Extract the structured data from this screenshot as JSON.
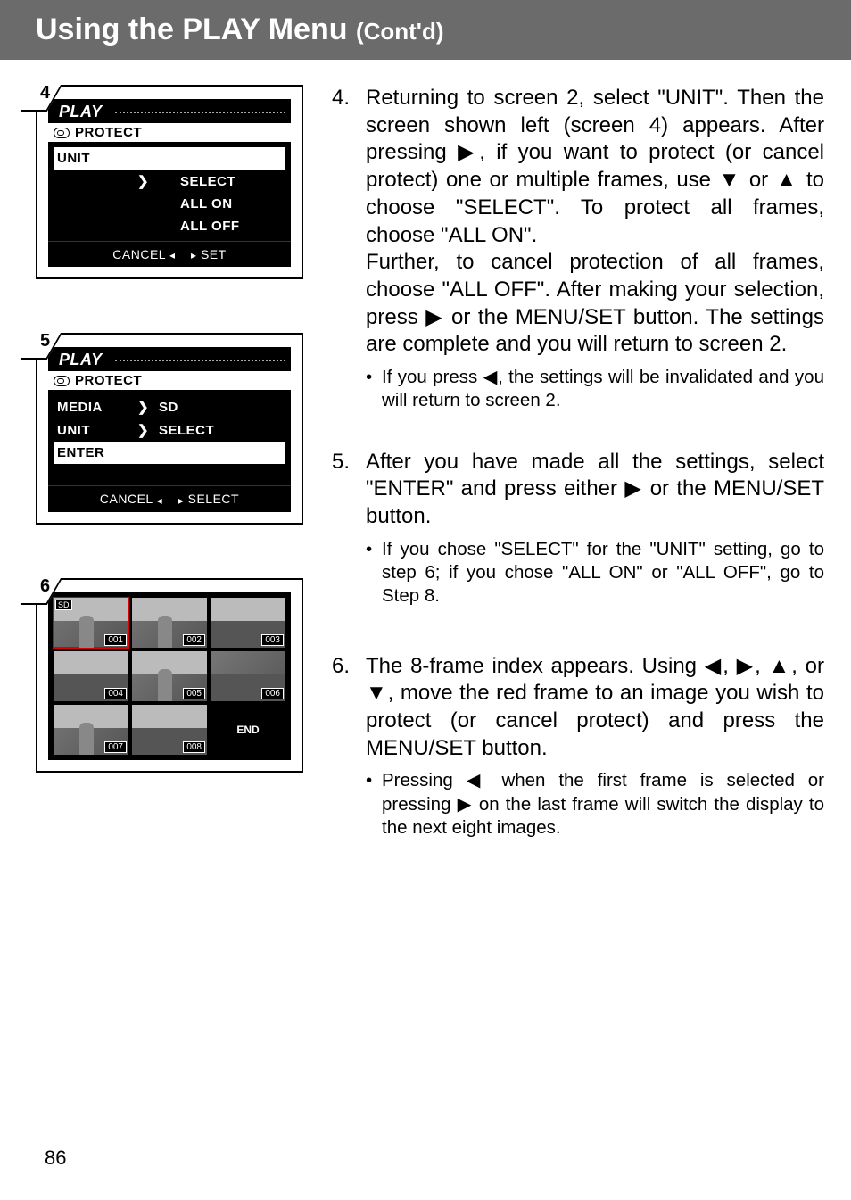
{
  "header": {
    "title_main": "Using the PLAY Menu ",
    "title_sub": "(Cont'd)"
  },
  "screens": {
    "s4": {
      "badge": "4",
      "title": "PLAY",
      "subtitle_icon": "key-icon",
      "subtitle": "PROTECT",
      "rows": [
        {
          "label": "UNIT",
          "arrow": "",
          "value": "",
          "highlight": true
        },
        {
          "label": "",
          "arrow": "❯",
          "value": "SELECT",
          "highlight": false,
          "indent": true
        },
        {
          "label": "",
          "arrow": "",
          "value": "ALL ON",
          "highlight": false,
          "indent": true
        },
        {
          "label": "",
          "arrow": "",
          "value": "ALL OFF",
          "highlight": false,
          "indent": true
        }
      ],
      "footer_left": "CANCEL",
      "footer_left_sym": "◂",
      "footer_right_sym": "▸",
      "footer_right": "SET"
    },
    "s5": {
      "badge": "5",
      "title": "PLAY",
      "subtitle_icon": "key-icon",
      "subtitle": "PROTECT",
      "rows": [
        {
          "label": "MEDIA",
          "arrow": "❯",
          "value": "SD",
          "highlight": false
        },
        {
          "label": "UNIT",
          "arrow": "❯",
          "value": "SELECT",
          "highlight": false
        },
        {
          "label": "ENTER",
          "arrow": "",
          "value": "",
          "highlight": true
        }
      ],
      "footer_left": "CANCEL",
      "footer_left_sym": "◂",
      "footer_right_sym": "▸",
      "footer_right": "SELECT"
    },
    "s6": {
      "badge": "6",
      "sd_badge": "SD",
      "thumbs": [
        "001",
        "002",
        "003",
        "004",
        "005",
        "006",
        "007",
        "008"
      ],
      "end": "END"
    }
  },
  "steps": {
    "s4": {
      "num": "4.",
      "para1": "Returning to screen 2, select \"UNIT\". Then the screen shown left (screen 4) appears. After pressing ▶, if you want to protect (or cancel protect) one or multiple frames, use ▼ or ▲ to choose \"SELECT\". To protect all frames, choose \"ALL ON\".",
      "para2": "Further, to cancel protection of all frames, choose \"ALL OFF\". After making your selection, press ▶ or the MENU/SET button. The settings are complete and you will return to screen 2.",
      "bullet1": "If you press ◀, the settings will be invalidated and you will return to screen 2."
    },
    "s5": {
      "num": "5.",
      "para1": "After you have made all the settings, select \"ENTER\" and press either ▶ or the MENU/SET button.",
      "bullet1": "If you chose \"SELECT\" for the \"UNIT\" setting, go to step 6; if you chose \"ALL ON\" or \"ALL OFF\", go to Step 8."
    },
    "s6": {
      "num": "6.",
      "para1": "The 8-frame index appears. Using ◀, ▶, ▲, or ▼, move the red frame to an image you wish to protect (or cancel protect) and press the MENU/SET button.",
      "bullet1": "Pressing ◀ when the first frame is selected or pressing ▶ on the last frame will switch the display to the next eight images."
    }
  },
  "page_number": "86"
}
